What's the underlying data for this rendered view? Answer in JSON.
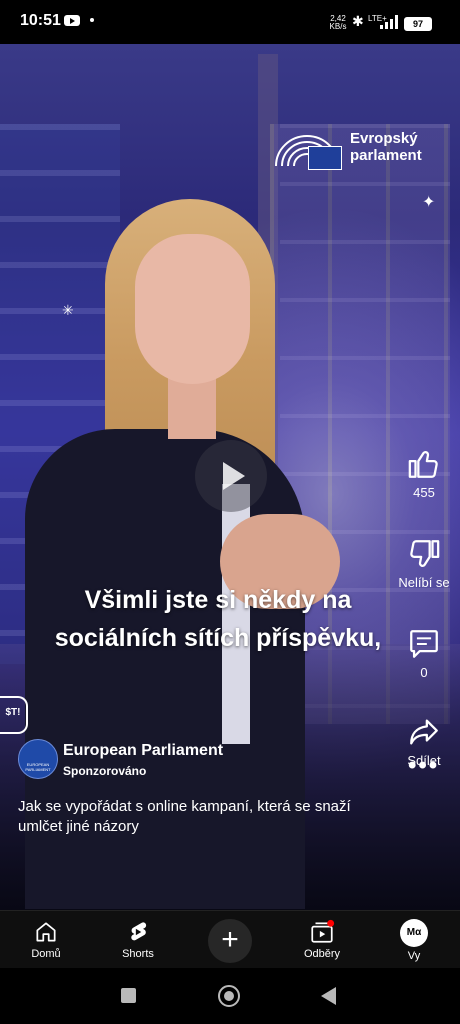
{
  "status": {
    "time": "10:51",
    "net_speed": "2,42\nKB/s",
    "network": "LTE+",
    "battery": "97"
  },
  "logo": {
    "line1": "Evropský",
    "line2": "parlament"
  },
  "caption": {
    "line1": "Všimli jste si někdy na",
    "line2": "sociálních sítích příspěvku,"
  },
  "actions": {
    "like_count": "455",
    "dislike_label": "Nelíbí se",
    "comment_count": "0",
    "share_label": "Sdílet"
  },
  "channel": {
    "name": "European Parliament",
    "sponsored": "Sponzorováno",
    "avatar_text": "EUROPEAN PARLIAMENT"
  },
  "description": "Jak se vypořádat s online kampaní, která se snaží umlčet jiné názory",
  "sticker": "$T!",
  "nav": {
    "home": "Domů",
    "shorts": "Shorts",
    "subscriptions": "Odběry",
    "you": "Vy",
    "avatar_text": "Mα"
  },
  "colors": {
    "accent": "#ff0000",
    "eu_blue": "#1f3f9a"
  }
}
